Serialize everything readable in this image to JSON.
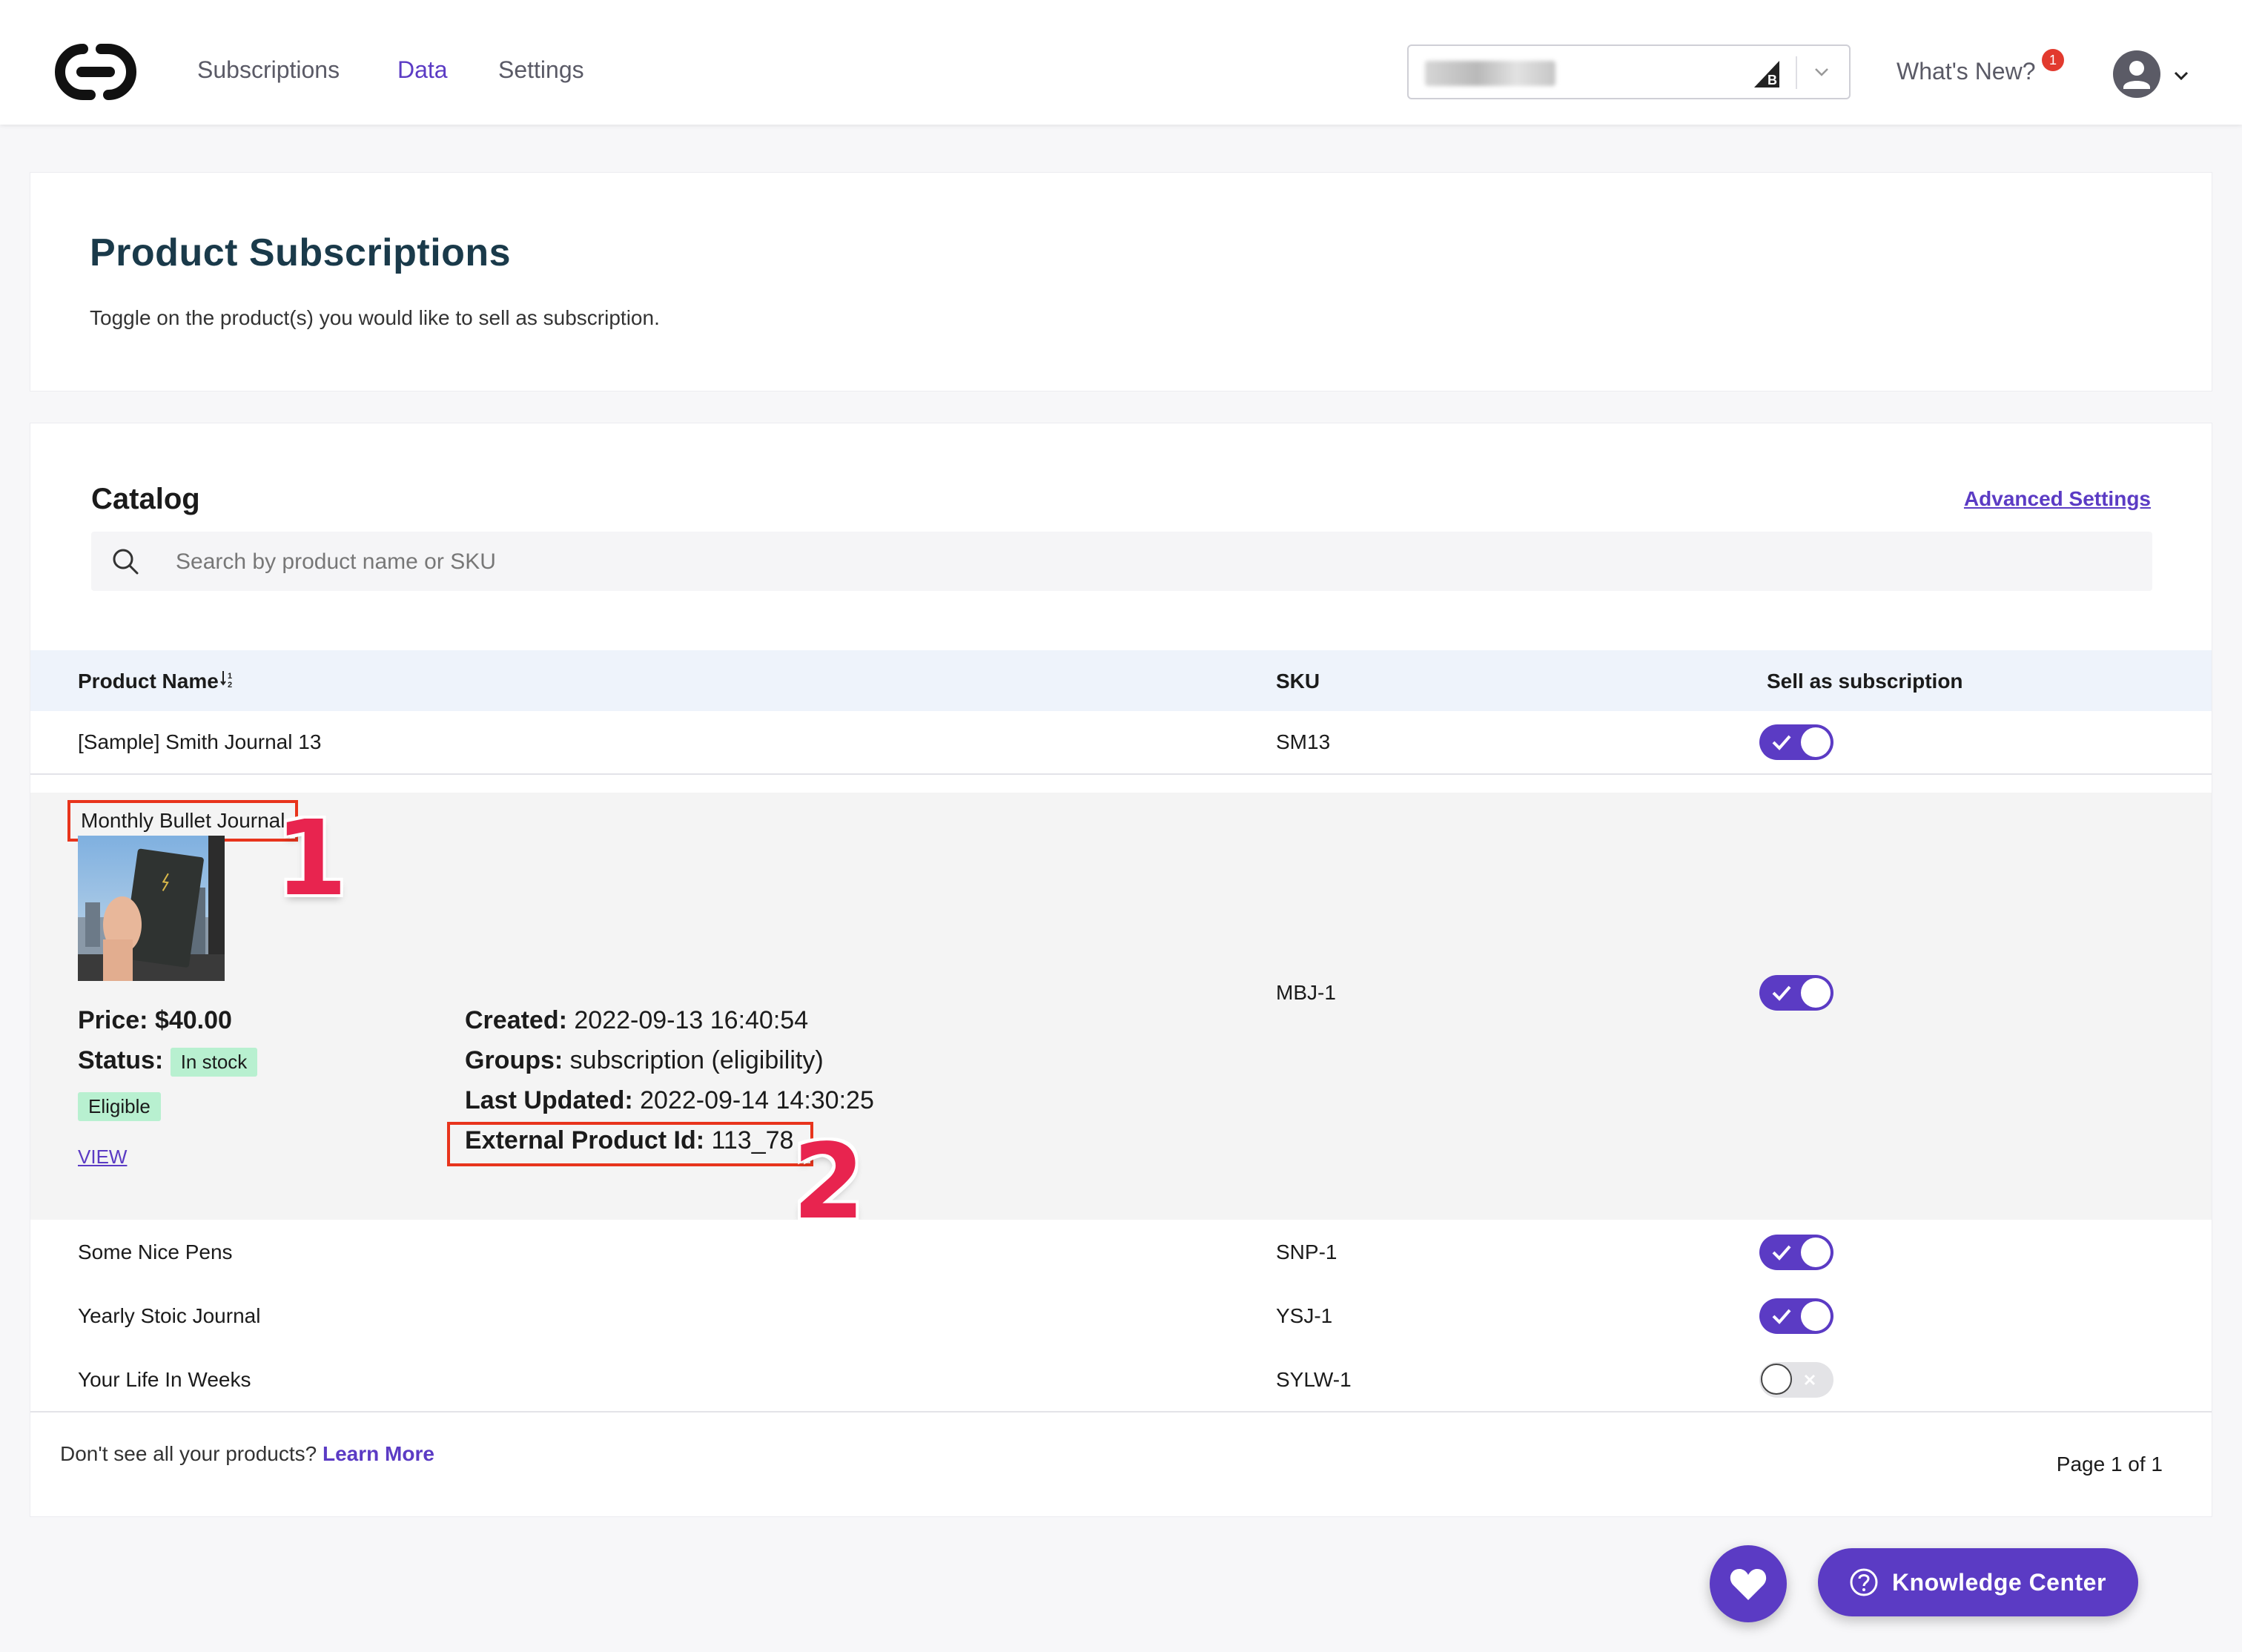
{
  "nav": {
    "links": [
      {
        "label": "Subscriptions",
        "active": false
      },
      {
        "label": "Data",
        "active": true
      },
      {
        "label": "Settings",
        "active": false
      }
    ],
    "whats_new_label": "What's New?",
    "notification_count": "1"
  },
  "header": {
    "title": "Product Subscriptions",
    "subtitle": "Toggle on the product(s) you would like to sell as subscription."
  },
  "catalog": {
    "title": "Catalog",
    "advanced_settings_label": "Advanced Settings",
    "search_placeholder": "Search by product name or SKU",
    "columns": [
      "Product Name",
      "SKU",
      "Sell as subscription"
    ],
    "rows": [
      {
        "name": "[Sample] Smith Journal 13",
        "sku": "SM13",
        "subscribed": true
      },
      {
        "name": "Monthly Bullet Journal",
        "sku": "MBJ-1",
        "subscribed": true
      },
      {
        "name": "Some Nice Pens",
        "sku": "SNP-1",
        "subscribed": true
      },
      {
        "name": "Yearly Stoic Journal",
        "sku": "YSJ-1",
        "subscribed": true
      },
      {
        "name": "Your Life In Weeks",
        "sku": "SYLW-1",
        "subscribed": false
      }
    ],
    "expanded": {
      "price_label": "Price:",
      "price": "$40.00",
      "status_label": "Status:",
      "status": "In stock",
      "eligibility": "Eligible",
      "view_label": "VIEW",
      "created_label": "Created:",
      "created": "2022-09-13 16:40:54",
      "groups_label": "Groups:",
      "groups": "subscription (eligibility)",
      "last_updated_label": "Last Updated:",
      "last_updated": "2022-09-14 14:30:25",
      "external_id_label": "External Product Id:",
      "external_id": "113_78"
    },
    "footer_text": "Don't see all your products?",
    "learn_more_label": "Learn More",
    "page_label": "Page 1 of 1"
  },
  "annotations": {
    "marker_1": "1",
    "marker_2": "2"
  },
  "knowledge_center_label": "Knowledge Center",
  "colors": {
    "accent": "#5b3bc4",
    "highlight": "#e8341c",
    "marker": "#e8244f",
    "eligible_bg": "#b8f0d0"
  },
  "icons": [
    "logo-icon",
    "bigcommerce-icon",
    "chevron-down-icon",
    "user-icon",
    "search-icon",
    "sort-icon",
    "check-icon",
    "x-icon",
    "heart-icon",
    "question-circle-icon"
  ]
}
